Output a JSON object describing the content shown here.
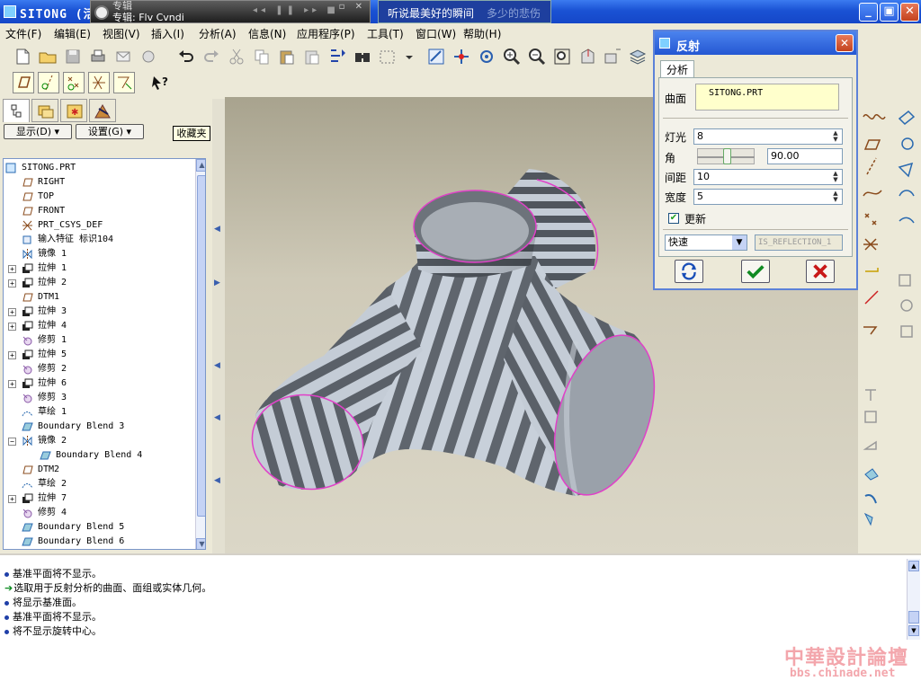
{
  "window": {
    "title": "SITONG (活",
    "player_line1": "专辑",
    "player_line2": "专辑: Flv Cvndi",
    "lyric_current": "听说最美好的瞬间",
    "lyric_next": "多少的悲伤",
    "minimize": "_",
    "maximize": "▣",
    "close": "✕"
  },
  "menu": [
    "文件(F)",
    "编辑(E)",
    "视图(V)",
    "插入(I)",
    "分析(A)",
    "信息(N)",
    "应用程序(P)",
    "工具(T)",
    "窗口(W)",
    "帮助(H)"
  ],
  "panel": {
    "show_button": "显示(D)",
    "settings_button": "设置(G)",
    "favorites": "收藏夹"
  },
  "tree": [
    {
      "label": "SITONG.PRT",
      "icon": "part-icon",
      "expand": false,
      "indent": 0
    },
    {
      "label": "RIGHT",
      "icon": "datum-plane-icon",
      "expand": false,
      "indent": 1
    },
    {
      "label": "TOP",
      "icon": "datum-plane-icon",
      "expand": false,
      "indent": 1
    },
    {
      "label": "FRONT",
      "icon": "datum-plane-icon",
      "expand": false,
      "indent": 1
    },
    {
      "label": "PRT_CSYS_DEF",
      "icon": "csys-icon",
      "expand": false,
      "indent": 1
    },
    {
      "label": "输入特征 标识104",
      "icon": "import-feature-icon",
      "expand": false,
      "indent": 1
    },
    {
      "label": "镜像 1",
      "icon": "mirror-icon",
      "expand": false,
      "indent": 1
    },
    {
      "label": "拉伸 1",
      "icon": "extrude-icon",
      "expand": true,
      "indent": 1
    },
    {
      "label": "拉伸 2",
      "icon": "extrude-icon",
      "expand": true,
      "indent": 1
    },
    {
      "label": "DTM1",
      "icon": "datum-plane-icon",
      "expand": false,
      "indent": 1
    },
    {
      "label": "拉伸 3",
      "icon": "extrude-icon",
      "expand": true,
      "indent": 1
    },
    {
      "label": "拉伸 4",
      "icon": "extrude-icon",
      "expand": true,
      "indent": 1
    },
    {
      "label": "修剪 1",
      "icon": "trim-icon",
      "expand": false,
      "indent": 1
    },
    {
      "label": "拉伸 5",
      "icon": "extrude-icon",
      "expand": true,
      "indent": 1
    },
    {
      "label": "修剪 2",
      "icon": "trim-icon",
      "expand": false,
      "indent": 1
    },
    {
      "label": "拉伸 6",
      "icon": "extrude-icon",
      "expand": true,
      "indent": 1
    },
    {
      "label": "修剪 3",
      "icon": "trim-icon",
      "expand": false,
      "indent": 1
    },
    {
      "label": "草绘 1",
      "icon": "sketch-icon",
      "expand": false,
      "indent": 1
    },
    {
      "label": "Boundary Blend 3",
      "icon": "boundary-blend-icon",
      "expand": false,
      "indent": 1
    },
    {
      "label": "镜像 2",
      "icon": "mirror-icon",
      "expand": "minus",
      "indent": 1
    },
    {
      "label": "Boundary Blend 4",
      "icon": "boundary-blend-icon",
      "expand": false,
      "indent": 2
    },
    {
      "label": "DTM2",
      "icon": "datum-plane-icon",
      "expand": false,
      "indent": 1
    },
    {
      "label": "草绘 2",
      "icon": "sketch-icon",
      "expand": false,
      "indent": 1
    },
    {
      "label": "拉伸 7",
      "icon": "extrude-icon",
      "expand": true,
      "indent": 1
    },
    {
      "label": "修剪 4",
      "icon": "trim-icon",
      "expand": false,
      "indent": 1
    },
    {
      "label": "Boundary Blend 5",
      "icon": "boundary-blend-icon",
      "expand": false,
      "indent": 1
    },
    {
      "label": "Boundary Blend 6",
      "icon": "boundary-blend-icon",
      "expand": false,
      "indent": 1
    }
  ],
  "dialog": {
    "title": "反射",
    "tab": "分析",
    "surface_label": "曲面",
    "surface_value": "SITONG.PRT",
    "light_label": "灯光",
    "light_value": "8",
    "angle_label": "角",
    "angle_value": "90.00",
    "spacing_label": "间距",
    "spacing_value": "10",
    "width_label": "宽度",
    "width_value": "5",
    "update_label": "更新",
    "update_checked": true,
    "mode_value": "快速",
    "result_name": "IS_REFLECTION_1"
  },
  "messages": [
    {
      "type": "info",
      "text": "基准平面将不显示。"
    },
    {
      "type": "prompt",
      "text": "选取用于反射分析的曲面、面组或实体几何。"
    },
    {
      "type": "info",
      "text": "将显示基准面。"
    },
    {
      "type": "info",
      "text": "基准平面将不显示。"
    },
    {
      "type": "info",
      "text": "将不显示旋转中心。"
    }
  ],
  "watermark": {
    "title": "中華設計論壇",
    "url": "bbs.chinade.net"
  },
  "colors": {
    "titlebar": "#1a52d4",
    "edge_highlight": "#e040c8",
    "stripe_dark": "#5a6068",
    "stripe_light": "#c4ccd6"
  }
}
